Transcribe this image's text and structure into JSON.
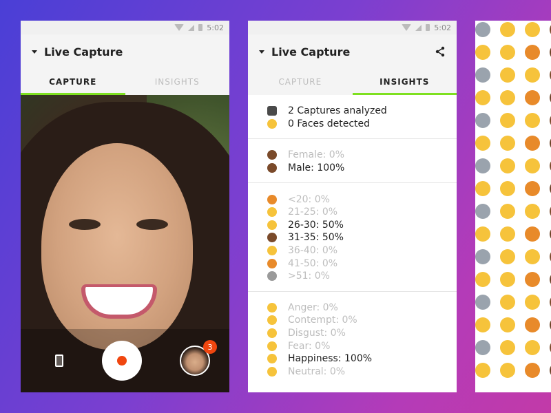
{
  "status_bar": {
    "time": "5:02"
  },
  "capture_screen": {
    "title": "Live Capture",
    "tabs": [
      {
        "label": "CAPTURE"
      },
      {
        "label": "INSIGHTS"
      }
    ],
    "badge_count": "3"
  },
  "insights_screen": {
    "title": "Live Capture",
    "tabs": [
      {
        "label": "CAPTURE"
      },
      {
        "label": "INSIGHTS"
      }
    ],
    "summary": [
      {
        "text": "2 Captures analyzed",
        "icon": "camera-icon"
      },
      {
        "text": "0 Faces detected",
        "icon": "face-icon"
      }
    ],
    "gender": [
      {
        "text": "Female: 0%",
        "highlighted": false,
        "icon": "woman-icon"
      },
      {
        "text": "Male: 100%",
        "highlighted": true,
        "icon": "man-icon"
      }
    ],
    "age": [
      {
        "text": "<20: 0%",
        "highlighted": false,
        "icon": "baby-icon"
      },
      {
        "text": "21-25: 0%",
        "highlighted": false,
        "icon": "youth-icon"
      },
      {
        "text": "26-30: 50%",
        "highlighted": true,
        "icon": "young-adult-icon"
      },
      {
        "text": "31-35: 50%",
        "highlighted": true,
        "icon": "adult-icon"
      },
      {
        "text": "36-40: 0%",
        "highlighted": false,
        "icon": "adult-icon"
      },
      {
        "text": "41-50: 0%",
        "highlighted": false,
        "icon": "middle-aged-icon"
      },
      {
        "text": ">51: 0%",
        "highlighted": false,
        "icon": "elder-icon"
      }
    ],
    "emotion": [
      {
        "text": "Anger: 0%",
        "highlighted": false,
        "icon": "angry-face-icon"
      },
      {
        "text": "Contempt: 0%",
        "highlighted": false,
        "icon": "unamused-face-icon"
      },
      {
        "text": "Disgust: 0%",
        "highlighted": false,
        "icon": "disgusted-face-icon"
      },
      {
        "text": "Fear: 0%",
        "highlighted": false,
        "icon": "fearful-face-icon"
      },
      {
        "text": "Happiness: 100%",
        "highlighted": true,
        "icon": "smiling-face-icon"
      },
      {
        "text": "Neutral: 0%",
        "highlighted": false,
        "icon": "neutral-face-icon"
      }
    ]
  },
  "colors": {
    "accent_green": "#7ee020",
    "record_red": "#f0460f"
  }
}
